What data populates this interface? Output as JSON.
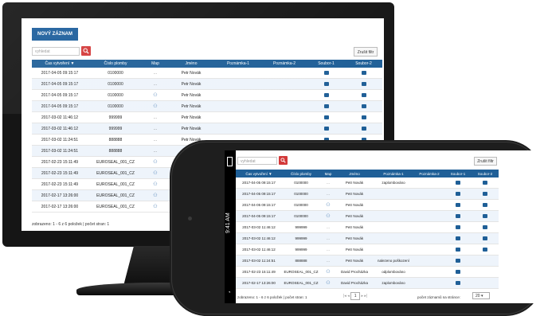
{
  "desktop": {
    "new_button": "NOVÝ ZÁZNAM",
    "search_placeholder": "vyhledat",
    "filter_button": "Zrušit filtr",
    "columns": [
      "Čas vytvoření ▼",
      "Číslo plomby",
      "Map",
      "Jméno",
      "Poznámka-1",
      "Poznámka-2",
      "Soubor-1",
      "Soubor-2"
    ],
    "rows": [
      {
        "time": "2017-04-05 09:15:17",
        "seal": "0100000",
        "map": "...",
        "name": "Petr Novák",
        "n1": "",
        "n2": "",
        "f1": true,
        "f2": true
      },
      {
        "time": "2017-04-05 09:15:17",
        "seal": "0100000",
        "map": "...",
        "name": "Petr Novák",
        "n1": "",
        "n2": "",
        "f1": true,
        "f2": true
      },
      {
        "time": "2017-04-05 09:15:17",
        "seal": "0100000",
        "map": "icon",
        "name": "Petr Novák",
        "n1": "",
        "n2": "",
        "f1": true,
        "f2": true
      },
      {
        "time": "2017-04-05 09:15:17",
        "seal": "0100000",
        "map": "icon",
        "name": "Petr Novák",
        "n1": "",
        "n2": "",
        "f1": true,
        "f2": true
      },
      {
        "time": "2017-03-02 11:46:12",
        "seal": "999999",
        "map": "...",
        "name": "Petr Novák",
        "n1": "",
        "n2": "",
        "f1": true,
        "f2": true
      },
      {
        "time": "2017-03-02 11:46:12",
        "seal": "999999",
        "map": "...",
        "name": "Petr Novák",
        "n1": "",
        "n2": "",
        "f1": true,
        "f2": true
      },
      {
        "time": "2017-03-02 11:24:51",
        "seal": "888888",
        "map": "...",
        "name": "Petr Novák",
        "n1": "",
        "n2": "",
        "f1": true,
        "f2": true
      },
      {
        "time": "2017-03-02 11:24:51",
        "seal": "888888",
        "map": "...",
        "name": "",
        "n1": "",
        "n2": "",
        "f1": false,
        "f2": false
      },
      {
        "time": "2017-02-23 15:11:49",
        "seal": "EUROSEAL_001_CZ",
        "map": "icon",
        "name": "",
        "n1": "",
        "n2": "",
        "f1": false,
        "f2": false
      },
      {
        "time": "2017-02-23 15:11:49",
        "seal": "EUROSEAL_001_CZ",
        "map": "icon",
        "name": "",
        "n1": "",
        "n2": "",
        "f1": false,
        "f2": false
      },
      {
        "time": "2017-02-23 15:11:49",
        "seal": "EUROSEAL_001_CZ",
        "map": "icon",
        "name": "",
        "n1": "",
        "n2": "",
        "f1": false,
        "f2": false
      },
      {
        "time": "2017-02-17 13:26:00",
        "seal": "EUROSEAL_001_CZ",
        "map": "icon",
        "name": "",
        "n1": "",
        "n2": "",
        "f1": false,
        "f2": false
      },
      {
        "time": "2017-02-17 13:26:00",
        "seal": "EUROSEAL_001_CZ",
        "map": "icon",
        "name": "",
        "n1": "",
        "n2": "",
        "f1": false,
        "f2": false
      }
    ],
    "footer": "zobrazeno: 1 - 6 z 6 položek | počet stran: 1"
  },
  "mobile": {
    "status_time": "9:41 AM",
    "search_placeholder": "vyhledat",
    "filter_button": "Zrušit filtr",
    "columns": [
      "Čas vytvoření ▼",
      "Číslo plomby",
      "Map",
      "Jméno",
      "Poznámka-1",
      "Poznámka-2",
      "Soubor-1",
      "Soubor-2"
    ],
    "rows": [
      {
        "time": "2017-04-05 09:15:17",
        "seal": "0100000",
        "map": "...",
        "name": "Petr Novák",
        "n1": "zaplombováno",
        "n2": "",
        "f1": true,
        "f2": true
      },
      {
        "time": "2017-04-05 09:15:17",
        "seal": "0100000",
        "map": "...",
        "name": "Petr Novák",
        "n1": "",
        "n2": "",
        "f1": true,
        "f2": true
      },
      {
        "time": "2017-04-05 09:15:17",
        "seal": "0100000",
        "map": "icon",
        "name": "Petr Novák",
        "n1": "",
        "n2": "",
        "f1": true,
        "f2": true
      },
      {
        "time": "2017-04-05 09:15:17",
        "seal": "0100000",
        "map": "icon",
        "name": "Petr Novák",
        "n1": "",
        "n2": "",
        "f1": true,
        "f2": true
      },
      {
        "time": "2017-03-02 11:46:12",
        "seal": "999999",
        "map": "...",
        "name": "Petr Novák",
        "n1": "",
        "n2": "",
        "f1": true,
        "f2": true
      },
      {
        "time": "2017-03-02 11:46:12",
        "seal": "999999",
        "map": "...",
        "name": "Petr Novák",
        "n1": "",
        "n2": "",
        "f1": true,
        "f2": true
      },
      {
        "time": "2017-03-02 11:46:12",
        "seal": "999999",
        "map": "...",
        "name": "Petr Novák",
        "n1": "",
        "n2": "",
        "f1": true,
        "f2": true
      },
      {
        "time": "2017-03-02 11:24:51",
        "seal": "888888",
        "map": "...",
        "name": "Petr Novák",
        "n1": "nalezeno poškození",
        "n2": "",
        "f1": true,
        "f2": false
      },
      {
        "time": "2017-02-23 15:11:49",
        "seal": "EUROSEAL_001_CZ",
        "map": "icon",
        "name": "David Procházka",
        "n1": "odplombováno",
        "n2": "",
        "f1": true,
        "f2": false
      },
      {
        "time": "2017-02-17 13:26:00",
        "seal": "EUROSEAL_001_CZ",
        "map": "icon",
        "name": "David Procházka",
        "n1": "zaplombováno",
        "n2": "",
        "f1": true,
        "f2": false
      }
    ],
    "footer": "zobrazeno: 1 - 6 z 6 položek | počet stran: 1",
    "pager_page": "1",
    "per_page_label": "počet záznamů na stránce:",
    "per_page_value": "20 ▾"
  },
  "colors": {
    "header": "#1f5f97",
    "button": "#1c5e9c",
    "search": "#d33a3a"
  },
  "icons": {
    "search": "magnifier-icon",
    "map": "people-icon",
    "file": "file-icon"
  }
}
